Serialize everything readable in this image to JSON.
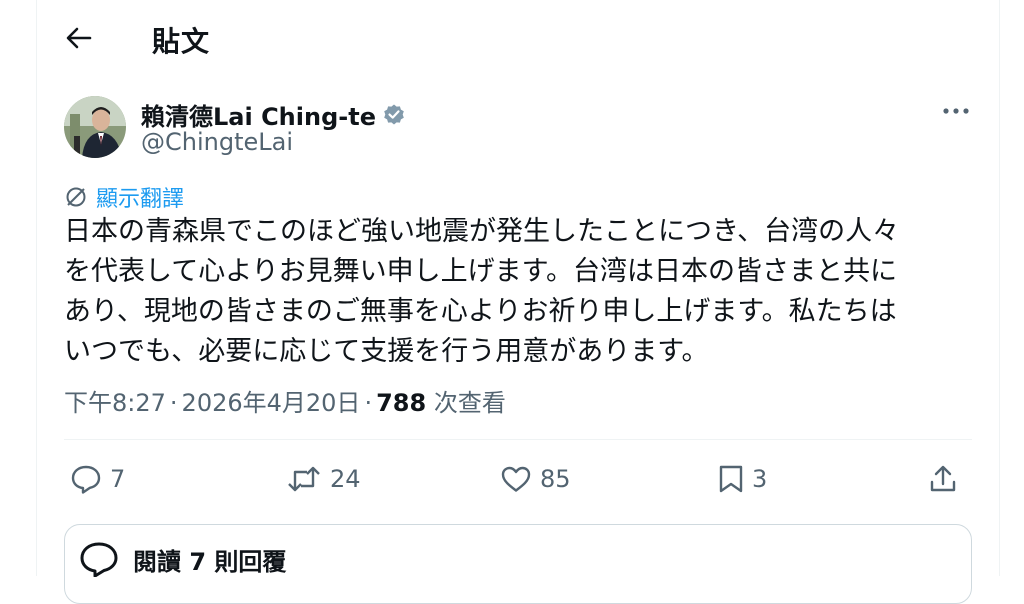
{
  "header": {
    "title": "貼文"
  },
  "author": {
    "display_name": "賴清德Lai Ching-te",
    "handle": "@ChingteLai",
    "verified": true
  },
  "tweet": {
    "translate_label": "顯示翻譯",
    "text": "日本の青森県でこのほど強い地震が発生したことにつき、台湾の人々\nを代表して心よりお見舞い申し上げます。台湾は日本の皆さまと共に\nあり、現地の皆さまのご無事を心よりお祈り申し上げます。私たちは\nいつでも、必要に応じて支援を行う用意があります。",
    "time": "下午8:27",
    "date": "2026年4月20日",
    "views_count": "788",
    "views_label": "次查看"
  },
  "actions": {
    "replies": "7",
    "reposts": "24",
    "likes": "85",
    "bookmarks": "3"
  },
  "replies_box": {
    "label": "閱讀 7 則回覆"
  },
  "colors": {
    "accent": "#1d9bf0",
    "text": "#0f1419",
    "secondary": "#536471",
    "border": "#eff3f4"
  }
}
